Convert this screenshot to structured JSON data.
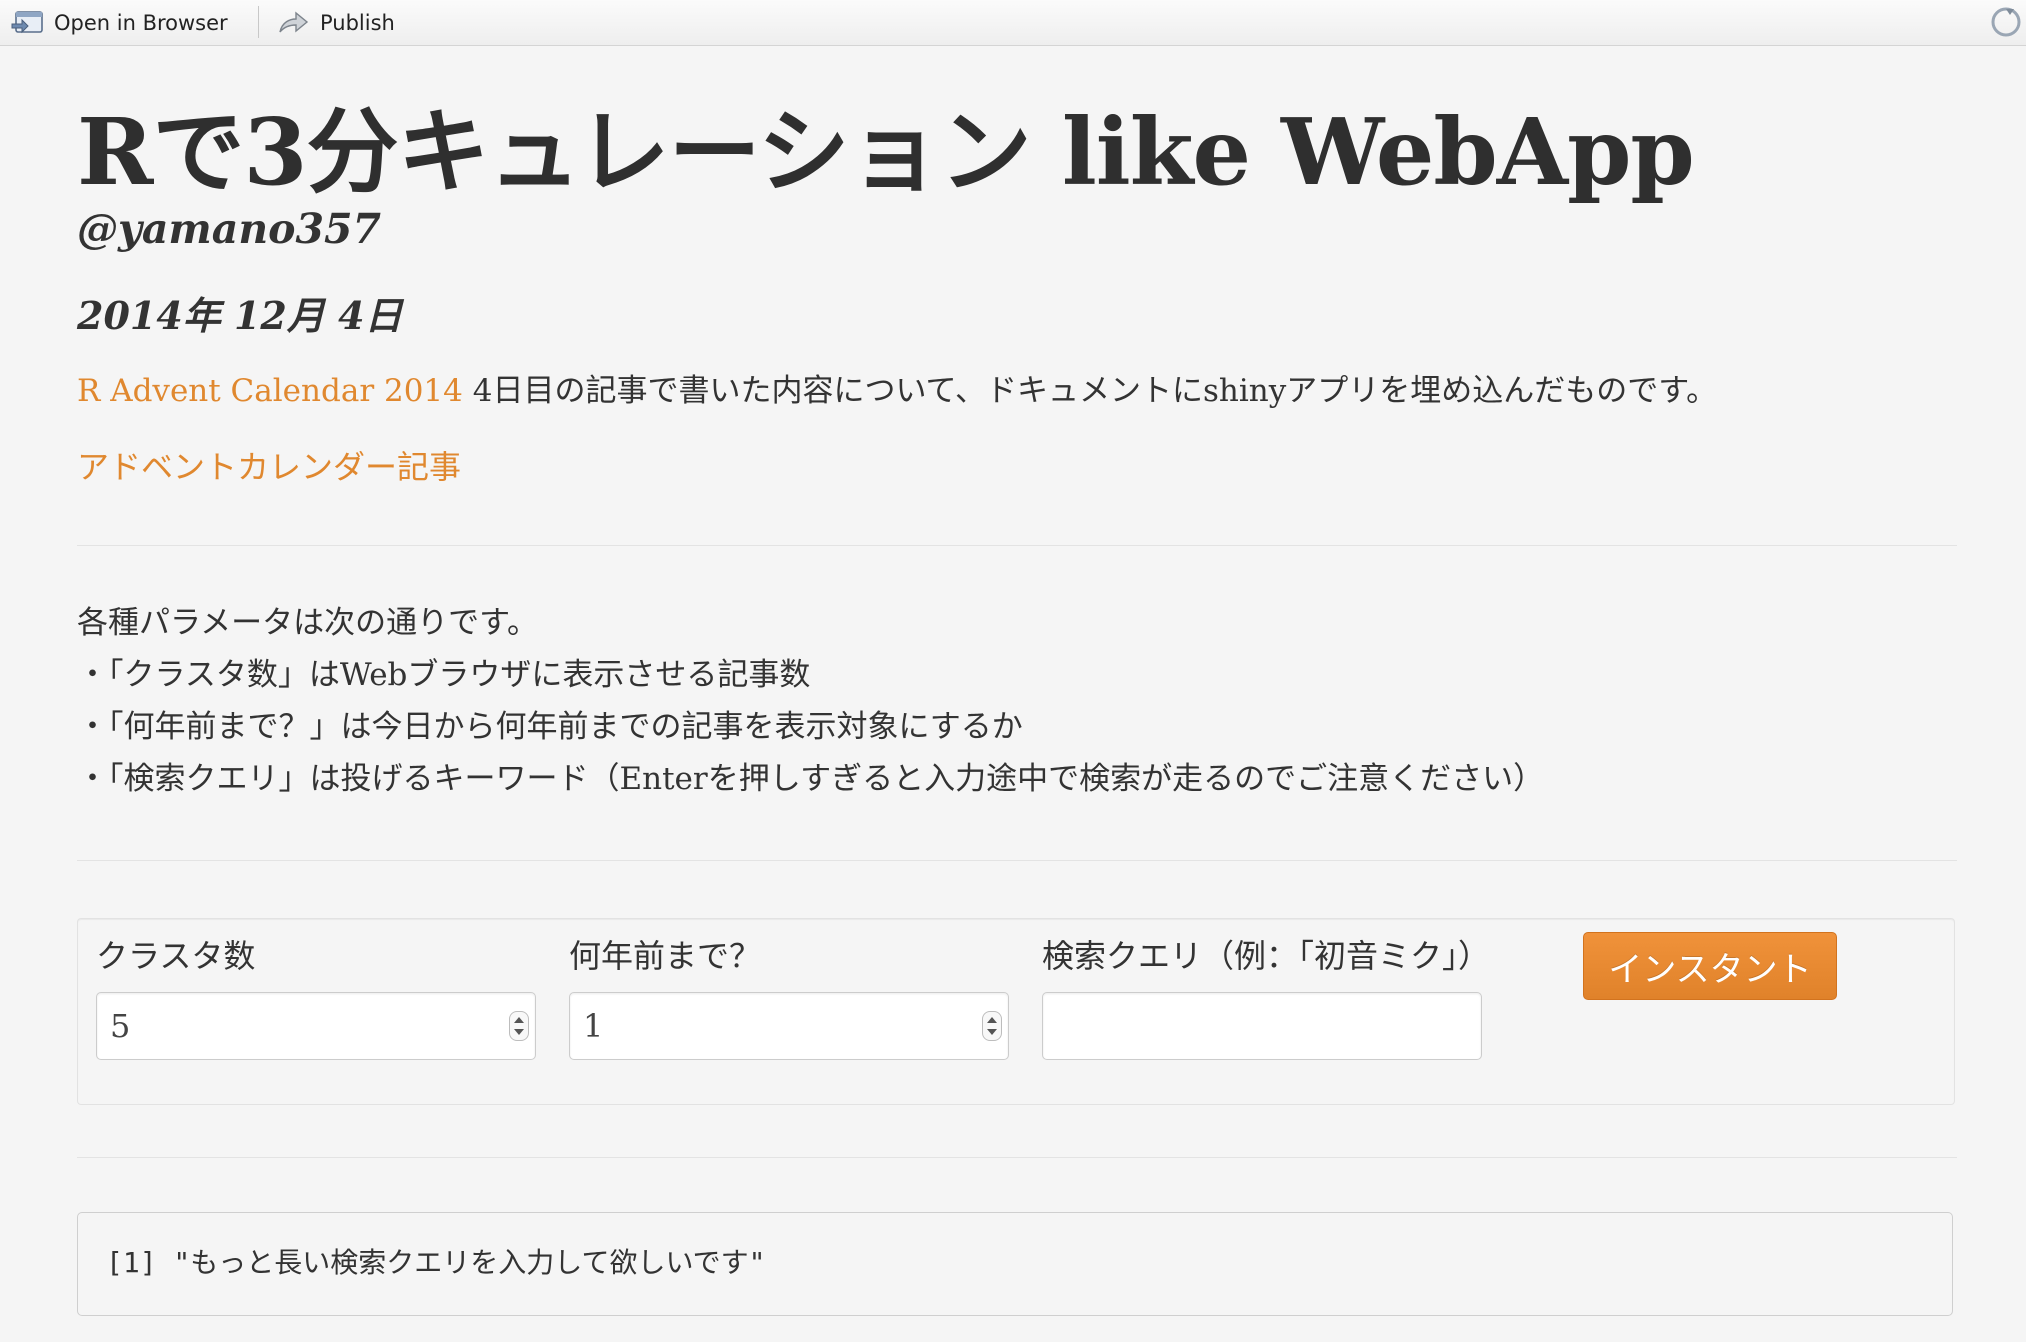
{
  "toolbar": {
    "open_in_browser": "Open in Browser",
    "publish": "Publish"
  },
  "header": {
    "title": "Rで3分キュレーション like WebApp",
    "author": "@yamano357",
    "date": "2014年 12月 4日"
  },
  "intro": {
    "link_text": "R Advent Calendar 2014",
    "text": " 4日目の記事で書いた内容について、ドキュメントにshinyアプリを埋め込んだものです。"
  },
  "article_link": "アドベントカレンダー記事",
  "params": {
    "heading": "各種パラメータは次の通りです。",
    "items": [
      "・「クラスタ数」はWebブラウザに表示させる記事数",
      "・「何年前まで？」は今日から何年前までの記事を表示対象にするか",
      "・「検索クエリ」は投げるキーワード（Enterを押しすぎると入力途中で検索が走るのでご注意ください）"
    ]
  },
  "form": {
    "cluster_label": "クラスタ数",
    "cluster_value": "5",
    "years_label": "何年前まで？",
    "years_value": "1",
    "query_label": "検索クエリ（例：「初音ミク」）",
    "query_value": "",
    "button_label": "インスタント"
  },
  "output": {
    "text": "[1] \"もっと長い検索クエリを入力して欲しいです\""
  },
  "colors": {
    "link": "#e0882f",
    "button": "#e8892f",
    "background": "#f5f5f5"
  },
  "icons": {
    "open_in_browser": "browser-window-icon",
    "publish": "publish-arrow-icon",
    "refresh": "refresh-icon"
  }
}
